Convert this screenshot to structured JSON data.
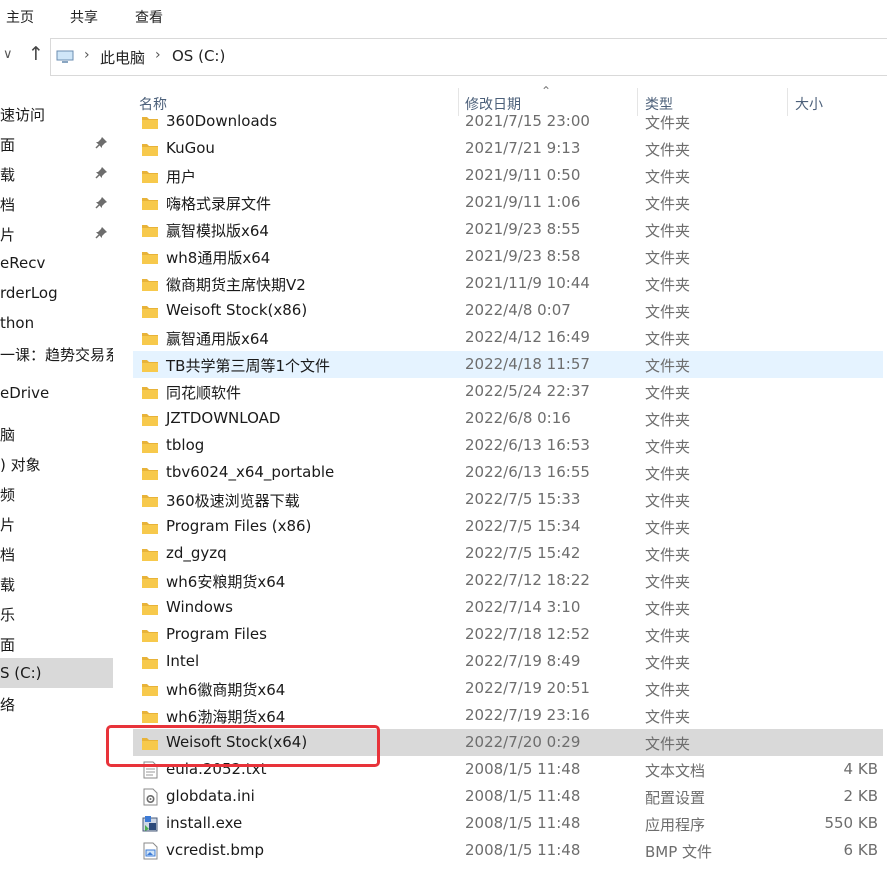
{
  "ribbon": {
    "tab_home": "主页",
    "tab_share": "共享",
    "tab_view": "查看"
  },
  "address": {
    "icons": [
      "chevron-down-icon",
      "up-arrow-icon",
      "this-pc-icon",
      "chevron-right-icon"
    ],
    "crumbs": [
      "此电脑",
      "OS (C:)"
    ]
  },
  "nav": {
    "items": [
      {
        "label": "速访问",
        "pinned": false
      },
      {
        "label": "面",
        "pinned": true
      },
      {
        "label": "载",
        "pinned": true
      },
      {
        "label": "档",
        "pinned": true
      },
      {
        "label": "片",
        "pinned": true
      },
      {
        "label": "eRecv",
        "pinned": false
      },
      {
        "label": "rderLog",
        "pinned": false
      },
      {
        "label": "thon",
        "pinned": false
      },
      {
        "label": "一课：趋势交易系",
        "pinned": false
      },
      {
        "label": "eDrive",
        "pinned": false
      },
      {
        "label": "脑",
        "pinned": false
      },
      {
        "label": ") 对象",
        "pinned": false
      },
      {
        "label": "频",
        "pinned": false
      },
      {
        "label": "片",
        "pinned": false
      },
      {
        "label": "档",
        "pinned": false
      },
      {
        "label": "载",
        "pinned": false
      },
      {
        "label": "乐",
        "pinned": false
      },
      {
        "label": "面",
        "pinned": false
      },
      {
        "label": "S (C:)",
        "pinned": false,
        "selected": true
      },
      {
        "label": "络",
        "pinned": false
      }
    ]
  },
  "columns": {
    "name": "名称",
    "date": "修改日期",
    "type": "类型",
    "size": "大小"
  },
  "files": [
    {
      "name": "360Downloads",
      "date": "2021/7/15 23:00",
      "type": "文件夹",
      "size": "",
      "icon": "folder-icon"
    },
    {
      "name": "KuGou",
      "date": "2021/7/21 9:13",
      "type": "文件夹",
      "size": "",
      "icon": "folder-icon"
    },
    {
      "name": "用户",
      "date": "2021/9/11 0:50",
      "type": "文件夹",
      "size": "",
      "icon": "folder-icon"
    },
    {
      "name": "嗨格式录屏文件",
      "date": "2021/9/11 1:06",
      "type": "文件夹",
      "size": "",
      "icon": "folder-icon"
    },
    {
      "name": "赢智模拟版x64",
      "date": "2021/9/23 8:55",
      "type": "文件夹",
      "size": "",
      "icon": "folder-icon"
    },
    {
      "name": "wh8通用版x64",
      "date": "2021/9/23 8:58",
      "type": "文件夹",
      "size": "",
      "icon": "folder-icon"
    },
    {
      "name": "徽商期货主席快期V2",
      "date": "2021/11/9 10:44",
      "type": "文件夹",
      "size": "",
      "icon": "folder-icon"
    },
    {
      "name": "Weisoft Stock(x86)",
      "date": "2022/4/8 0:07",
      "type": "文件夹",
      "size": "",
      "icon": "folder-icon"
    },
    {
      "name": "赢智通用版x64",
      "date": "2022/4/12 16:49",
      "type": "文件夹",
      "size": "",
      "icon": "folder-icon"
    },
    {
      "name": "TB共学第三周等1个文件",
      "date": "2022/4/18 11:57",
      "type": "文件夹",
      "size": "",
      "icon": "folder-icon",
      "state": "hover"
    },
    {
      "name": "同花顺软件",
      "date": "2022/5/24 22:37",
      "type": "文件夹",
      "size": "",
      "icon": "folder-icon"
    },
    {
      "name": "JZTDOWNLOAD",
      "date": "2022/6/8 0:16",
      "type": "文件夹",
      "size": "",
      "icon": "folder-icon"
    },
    {
      "name": "tblog",
      "date": "2022/6/13 16:53",
      "type": "文件夹",
      "size": "",
      "icon": "folder-icon"
    },
    {
      "name": "tbv6024_x64_portable",
      "date": "2022/6/13 16:55",
      "type": "文件夹",
      "size": "",
      "icon": "folder-icon"
    },
    {
      "name": "360极速浏览器下载",
      "date": "2022/7/5 15:33",
      "type": "文件夹",
      "size": "",
      "icon": "folder-icon"
    },
    {
      "name": "Program Files (x86)",
      "date": "2022/7/5 15:34",
      "type": "文件夹",
      "size": "",
      "icon": "folder-icon"
    },
    {
      "name": "zd_gyzq",
      "date": "2022/7/5 15:42",
      "type": "文件夹",
      "size": "",
      "icon": "folder-icon"
    },
    {
      "name": "wh6安粮期货x64",
      "date": "2022/7/12 18:22",
      "type": "文件夹",
      "size": "",
      "icon": "folder-icon"
    },
    {
      "name": "Windows",
      "date": "2022/7/14 3:10",
      "type": "文件夹",
      "size": "",
      "icon": "folder-icon"
    },
    {
      "name": "Program Files",
      "date": "2022/7/18 12:52",
      "type": "文件夹",
      "size": "",
      "icon": "folder-icon"
    },
    {
      "name": "Intel",
      "date": "2022/7/19 8:49",
      "type": "文件夹",
      "size": "",
      "icon": "folder-icon"
    },
    {
      "name": "wh6徽商期货x64",
      "date": "2022/7/19 20:51",
      "type": "文件夹",
      "size": "",
      "icon": "folder-icon"
    },
    {
      "name": "wh6渤海期货x64",
      "date": "2022/7/19 23:16",
      "type": "文件夹",
      "size": "",
      "icon": "folder-icon"
    },
    {
      "name": "Weisoft Stock(x64)",
      "date": "2022/7/20 0:29",
      "type": "文件夹",
      "size": "",
      "icon": "folder-icon",
      "state": "selected"
    },
    {
      "name": "eula.2052.txt",
      "date": "2008/1/5 11:48",
      "type": "文本文档",
      "size": "4 KB",
      "icon": "text-file-icon"
    },
    {
      "name": "globdata.ini",
      "date": "2008/1/5 11:48",
      "type": "配置设置",
      "size": "2 KB",
      "icon": "settings-file-icon"
    },
    {
      "name": "install.exe",
      "date": "2008/1/5 11:48",
      "type": "应用程序",
      "size": "550 KB",
      "icon": "installer-icon"
    },
    {
      "name": "vcredist.bmp",
      "date": "2008/1/5 11:48",
      "type": "BMP 文件",
      "size": "6 KB",
      "icon": "image-file-icon"
    }
  ],
  "colors": {
    "selection": "#d9d9d9",
    "hover": "#e5f3ff",
    "annotation": "#e8333a",
    "folder": "#f7c94c"
  }
}
